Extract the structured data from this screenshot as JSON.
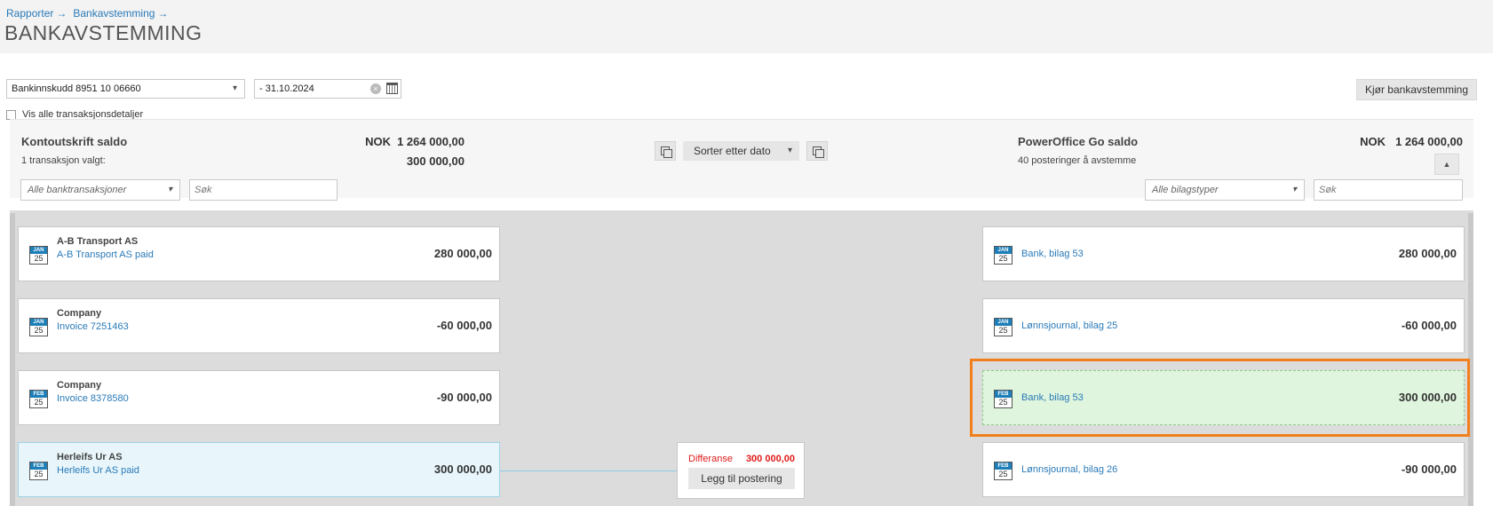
{
  "breadcrumb": [
    "Rapporter",
    "Bankavstemming"
  ],
  "page_title": "BANKAVSTEMMING",
  "controls": {
    "account_select": "Bankinnskudd 8951 10 06660",
    "date_value": "- 31.10.2024",
    "run_button": "Kjør bankavstemming",
    "show_details_label": "Vis alle transaksjonsdetaljer"
  },
  "left_header": {
    "title": "Kontoutskrift saldo",
    "currency": "NOK",
    "balance": "1 264 000,00",
    "selected_label": "1 transaksjon valgt:",
    "selected_amount": "300 000,00",
    "filter_placeholder": "Alle banktransaksjoner",
    "search_placeholder": "Søk"
  },
  "sort_label": "Sorter etter dato",
  "right_header": {
    "title": "PowerOffice Go saldo",
    "currency": "NOK",
    "balance": "1 264 000,00",
    "count_label": "40 posteringer å avstemme",
    "filter_placeholder": "Alle bilagstyper",
    "search_placeholder": "Søk"
  },
  "left_cards": [
    {
      "month": "JAN",
      "day": "25",
      "name": "A-B Transport AS",
      "link": "A-B Transport AS paid",
      "amount": "280 000,00"
    },
    {
      "month": "JAN",
      "day": "25",
      "name": "Company",
      "link": "Invoice 7251463",
      "amount": "-60 000,00"
    },
    {
      "month": "FEB",
      "day": "25",
      "name": "Company",
      "link": "Invoice 8378580",
      "amount": "-90 000,00"
    },
    {
      "month": "FEB",
      "day": "25",
      "name": "Herleifs Ur AS",
      "link": "Herleifs Ur AS paid",
      "amount": "300 000,00"
    }
  ],
  "right_cards": [
    {
      "month": "JAN",
      "day": "25",
      "link": "Bank, bilag 53",
      "amount": "280 000,00"
    },
    {
      "month": "JAN",
      "day": "25",
      "link": "Lønnsjournal, bilag 25",
      "amount": "-60 000,00"
    },
    {
      "month": "FEB",
      "day": "25",
      "link": "Bank, bilag 53",
      "amount": "300 000,00"
    },
    {
      "month": "FEB",
      "day": "25",
      "link": "Lønnsjournal, bilag 26",
      "amount": "-90 000,00"
    }
  ],
  "difference": {
    "label": "Differanse",
    "amount": "300 000,00",
    "button": "Legg til postering"
  },
  "colors": {
    "link": "#2a7ab8",
    "highlight": "#f27f1b",
    "selected_bg": "#e8f6fb",
    "matched_bg": "#dff5dd",
    "difference": "#e01b1b"
  }
}
